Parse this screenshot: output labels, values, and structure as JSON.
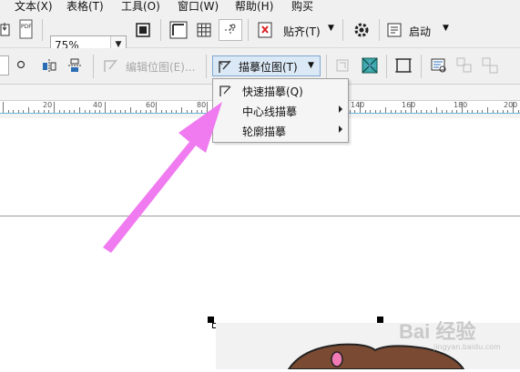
{
  "menubar": {
    "items": [
      "文本(X)",
      "表格(T)",
      "工具(O)",
      "窗口(W)",
      "帮助(H)",
      "购买"
    ]
  },
  "toolbar": {
    "zoom_value": "75%",
    "snap_label": "贴齐(T)",
    "launch_label": "启动",
    "pdf_label": "PDF"
  },
  "property_bar": {
    "edit_bitmap_label": "编辑位图(E)...",
    "trace_bitmap_label": "描摹位图(T)"
  },
  "trace_menu": {
    "items": [
      {
        "label": "快速描摹(Q)",
        "has_submenu": false,
        "icon": "quick-trace-icon"
      },
      {
        "label": "中心线描摹",
        "has_submenu": true
      },
      {
        "label": "轮廓描摹",
        "has_submenu": true
      }
    ]
  },
  "ruler": {
    "labels": [
      "20",
      "40",
      "60",
      "80",
      "140",
      "160",
      "180",
      "200"
    ]
  },
  "watermark": {
    "text": "Bai 经验",
    "sub": "jingyan.baidu.com"
  },
  "colors": {
    "accent_arrow": "#f07af0",
    "trace_button_bg": "#dbe9f6",
    "ruler_line": "#6ab6d6"
  }
}
